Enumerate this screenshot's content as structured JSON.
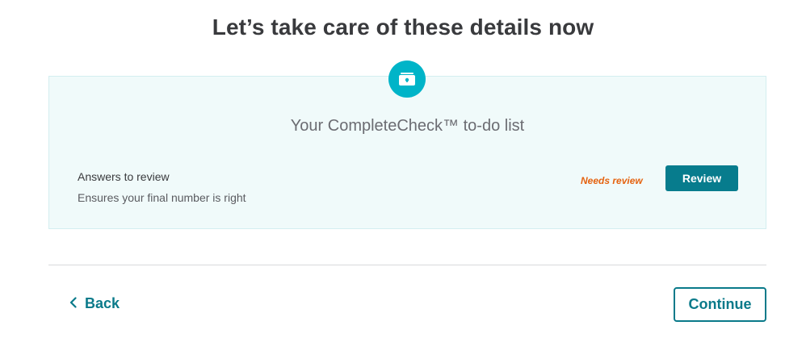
{
  "page": {
    "title": "Let’s take care of these details now"
  },
  "checklist": {
    "icon": "lockbox-icon",
    "title": "Your CompleteCheck™ to-do list",
    "items": [
      {
        "title": "Answers to review",
        "description": "Ensures your final number is right",
        "status": "Needs review",
        "action_label": "Review"
      }
    ]
  },
  "footer": {
    "back_label": "Back",
    "continue_label": "Continue"
  },
  "colors": {
    "accent": "#077c8d",
    "badge": "#00b4c8",
    "card_background": "#f0fafa",
    "status_warning": "#e5620f"
  }
}
